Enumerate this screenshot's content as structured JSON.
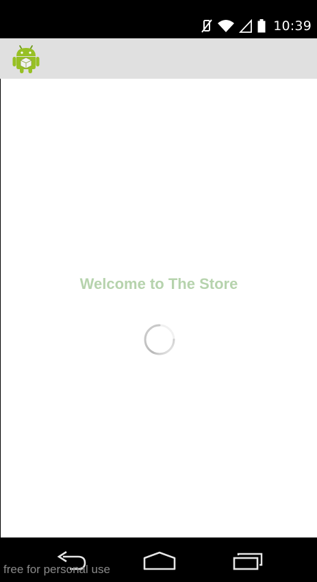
{
  "status_bar": {
    "time": "10:39",
    "icons": [
      "vibrate-mute-icon",
      "wifi-icon",
      "cell-signal-icon",
      "battery-icon"
    ]
  },
  "action_bar": {
    "icon": "android-robot-icon",
    "title": ""
  },
  "main": {
    "welcome_text": "Welcome to The Store",
    "loading": "spinner"
  },
  "nav_bar": {
    "buttons": [
      "back-icon",
      "home-icon",
      "recents-icon"
    ]
  },
  "watermark": "free for personal use",
  "colors": {
    "status_bar": "#000000",
    "action_bar": "#e0e0e0",
    "welcome_text": "#b6d3ad",
    "android_green": "#97c024",
    "background": "#ffffff"
  }
}
